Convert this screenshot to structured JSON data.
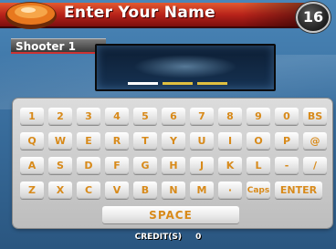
{
  "header": {
    "title": "Enter Your Name",
    "timer": "16"
  },
  "player": {
    "label": "Shooter",
    "number": "1"
  },
  "keyboard": {
    "rows": [
      [
        "1",
        "2",
        "3",
        "4",
        "5",
        "6",
        "7",
        "8",
        "9",
        "0",
        "BS"
      ],
      [
        "Q",
        "W",
        "E",
        "R",
        "T",
        "Y",
        "U",
        "I",
        "O",
        "P",
        "@"
      ],
      [
        "A",
        "S",
        "D",
        "F",
        "G",
        "H",
        "J",
        "K",
        "L",
        "-",
        "/"
      ],
      [
        "Z",
        "X",
        "C",
        "V",
        "B",
        "N",
        "M",
        "·",
        "Caps",
        "ENTER"
      ]
    ],
    "space_label": "SPACE"
  },
  "footer": {
    "credit_label": "CREDIT(S)",
    "credit_value": "0"
  },
  "colors": {
    "key_text": "#d88a1a",
    "title_bar": "#b8231a",
    "background": "#3a6f9f"
  }
}
